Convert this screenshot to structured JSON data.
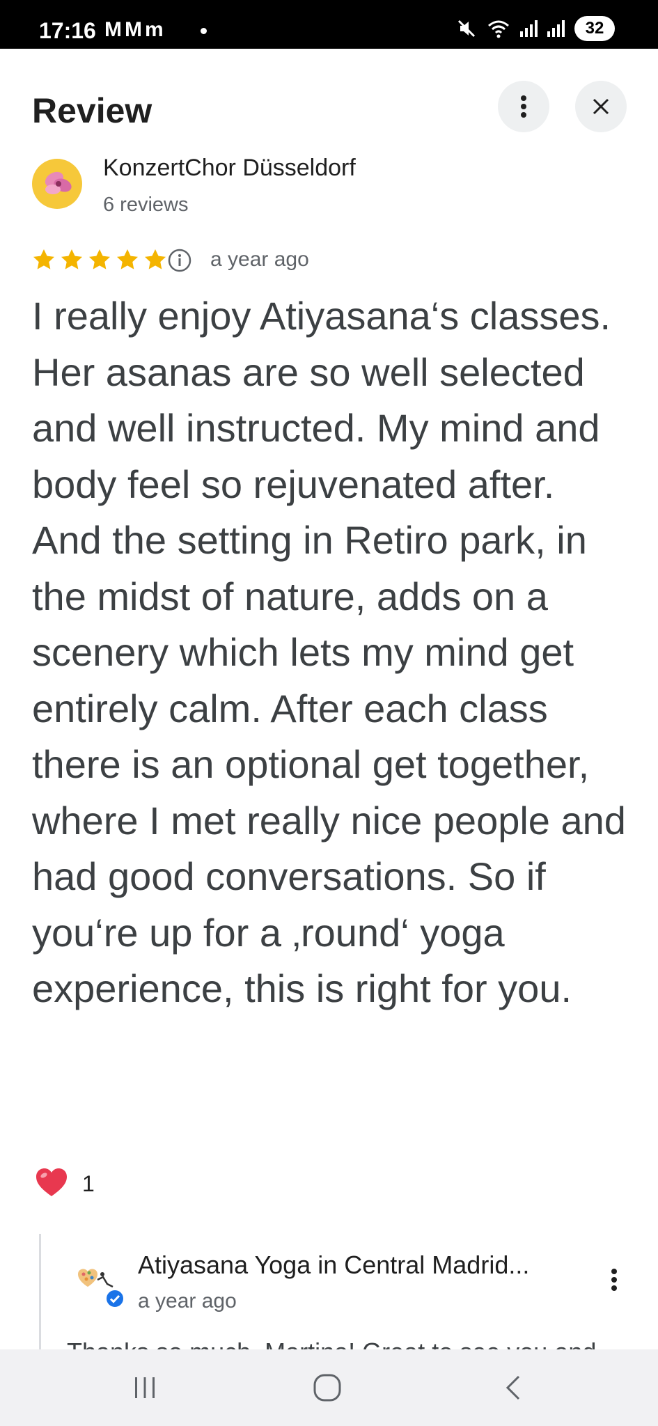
{
  "status_bar": {
    "time": "17:16",
    "left_icons": "MMm",
    "battery": "32"
  },
  "header": {
    "title": "Review"
  },
  "review": {
    "reviewer_name": "KonzertChor Düsseldorf",
    "reviewer_count": "6 reviews",
    "rating": 5,
    "age": "a year ago",
    "text": "I really enjoy Atiyasana‘s classes. Her asanas are so well selected and well instructed. My mind and body feel so rejuvenated after. And the setting in Retiro park, in the midst of nature, adds on a scenery which lets my mind get entirely calm. After each class there is an optional get together, where I met really nice people and had good conversations. So if you‘re up for a ‚round‘ yoga experience, this is right for you.",
    "likes": "1"
  },
  "owner_response": {
    "name": "Atiyasana Yoga in Central Madrid...",
    "age": "a year ago",
    "text_preview": "Thanks so much, Martina! Great to see you and"
  },
  "colors": {
    "star": "#f4b400",
    "heart": "#e8384f",
    "verified": "#1a73e8"
  }
}
